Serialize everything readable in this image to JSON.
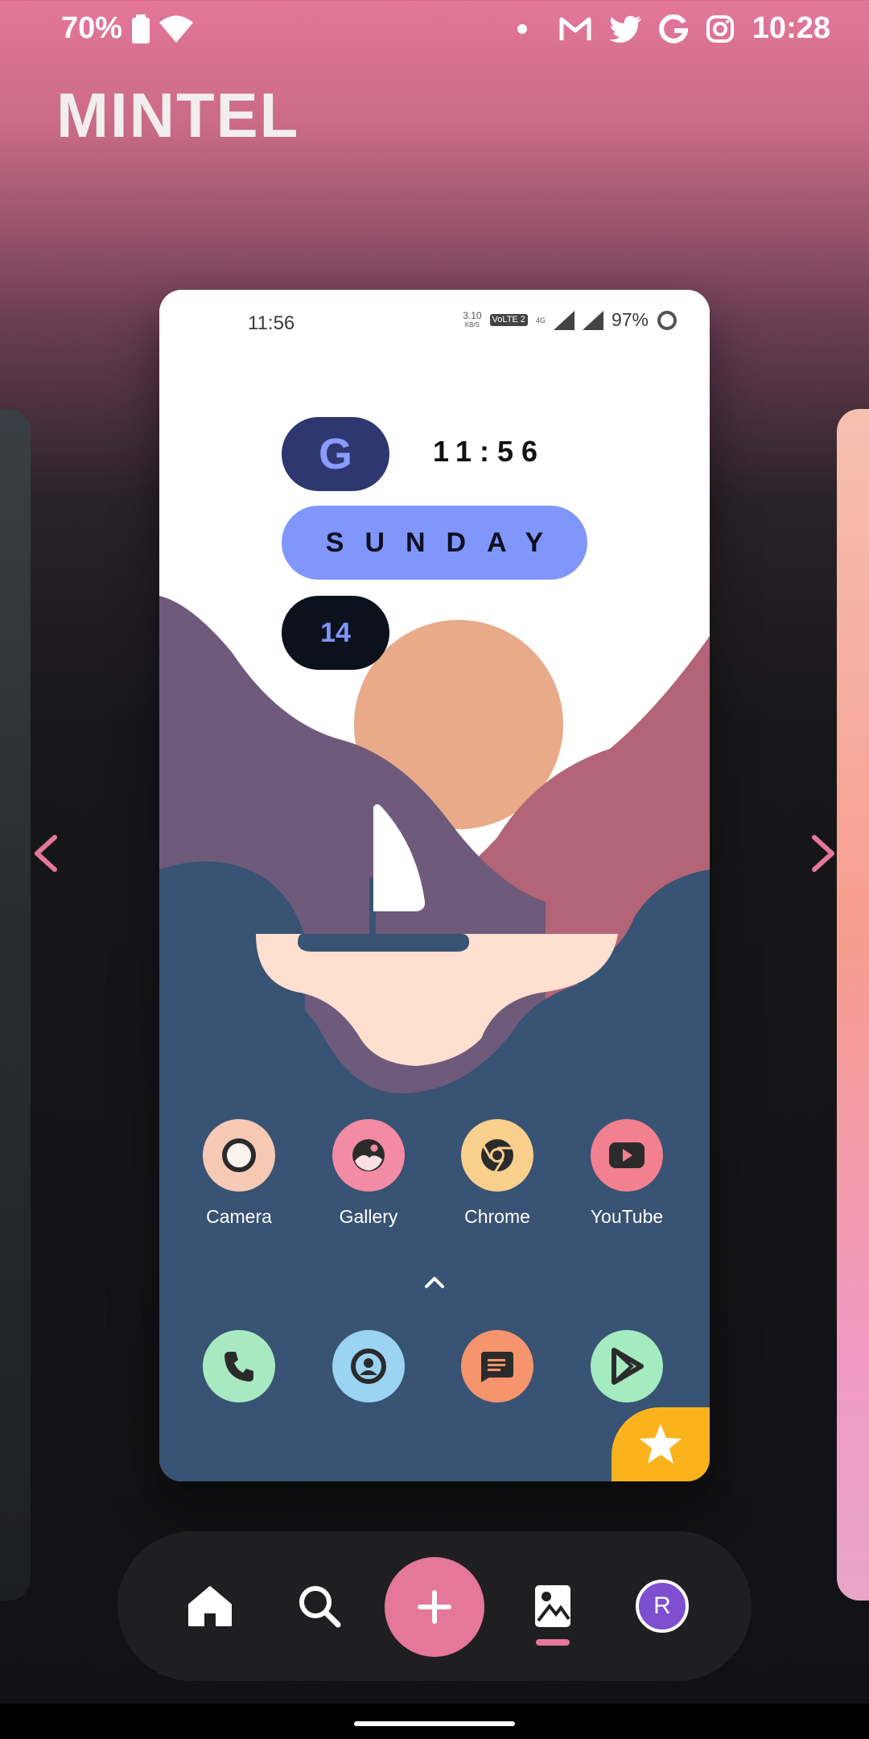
{
  "status_bar": {
    "battery_text": "70%",
    "time": "10:28",
    "notification_icons": [
      "gmail-icon",
      "twitter-icon",
      "google-icon",
      "instagram-icon"
    ]
  },
  "app": {
    "title": "MINTEL"
  },
  "preview": {
    "status": {
      "time": "11:56",
      "net_speed": "3.10",
      "net_unit": "KB/S",
      "volte": "VoLTE 2",
      "network": "4G",
      "battery": "97%"
    },
    "widget": {
      "g_label": "G",
      "clock": "11:56",
      "day": "SUNDAY",
      "date": "14"
    },
    "apps": [
      {
        "label": "Camera",
        "bg": "#f5c9b4"
      },
      {
        "label": "Gallery",
        "bg": "#f28ba3"
      },
      {
        "label": "Chrome",
        "bg": "#f8cf8d"
      },
      {
        "label": "YouTube",
        "bg": "#f2808f"
      }
    ],
    "dock": [
      {
        "icon": "phone-icon",
        "bg": "#a8e9c2"
      },
      {
        "icon": "contacts-icon",
        "bg": "#9bd3f2"
      },
      {
        "icon": "messages-icon",
        "bg": "#f6956d"
      },
      {
        "icon": "play-store-icon",
        "bg": "#a4ecbf"
      }
    ]
  },
  "bottom_nav": {
    "avatar_initial": "R"
  },
  "colors": {
    "accent": "#e4779a",
    "widget_blue": "#8196fb",
    "scene_navy": "#385373",
    "favorite_yellow": "#fab31c"
  }
}
